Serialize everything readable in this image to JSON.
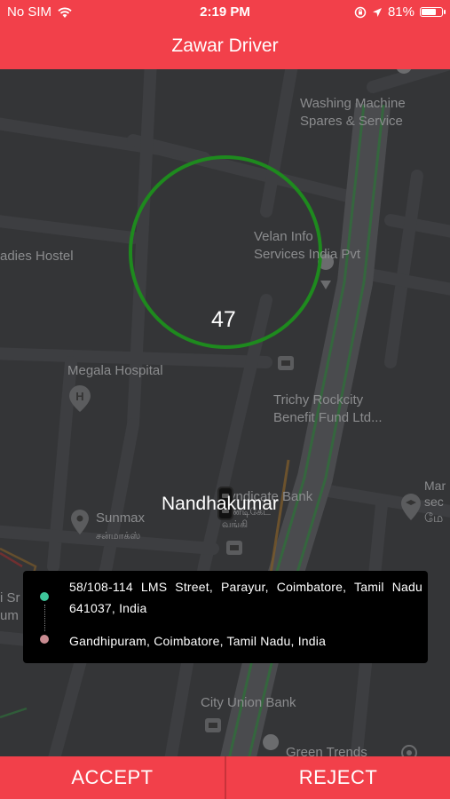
{
  "status_bar": {
    "carrier": "No SIM",
    "time": "2:19 PM",
    "battery": "81%",
    "battery_level": 0.81
  },
  "header": {
    "title": "Zawar Driver"
  },
  "map": {
    "labels": {
      "washing_machine": "Washing Machine\nSpares & Service",
      "velan_info": "Velan Info\nServices India Pvt",
      "ladies_hostel": "adies Hostel",
      "megala_hospital": "Megala Hospital",
      "trichy_rockcity": "Trichy Rockcity\nBenefit Fund Ltd...",
      "syndicate_bank": "Syndicate Bank",
      "syndicate_bank_tamil": "சிண்டிகேட்\nவங்கி",
      "sunmax": "Sunmax",
      "sunmax_tamil": "சன்மாக்ஸ்",
      "city_union_bank": "City Union Bank",
      "green_trends": "Green Trends",
      "right_edge_top": "Mar\nsec\nமே",
      "left_edge": "i Sr\num"
    },
    "timer_value": "47",
    "driver_name": "Nandhakumar"
  },
  "trip": {
    "pickup_address": "58/108-114 LMS Street, Parayur, Coimbatore, Tamil Nadu 641037, India",
    "drop_address": "Gandhipuram, Coimbatore, Tamil Nadu, India"
  },
  "actions": {
    "accept_label": "ACCEPT",
    "reject_label": "REJECT"
  },
  "colors": {
    "brand": "#f2404a",
    "timer_ring": "#1e8a1e",
    "pickup_dot": "#3ec59a",
    "drop_dot": "#c98b91"
  }
}
